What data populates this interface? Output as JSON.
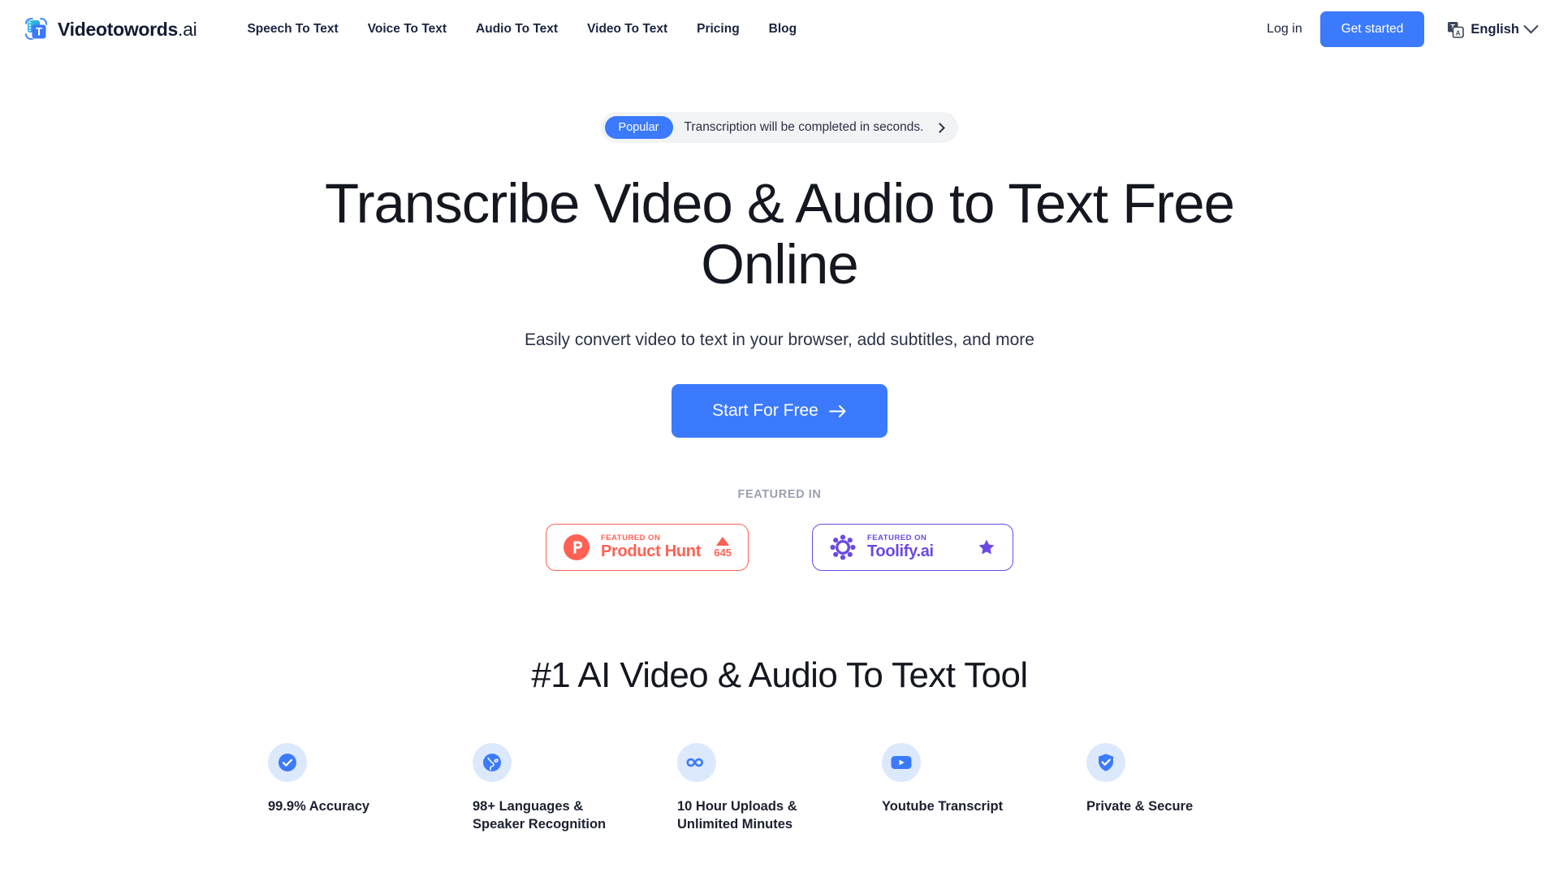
{
  "header": {
    "brand": {
      "name": "Videotowords",
      "suffix": ".ai",
      "logo_icon": "film-text-logo-icon"
    },
    "nav": [
      {
        "label": "Speech To Text"
      },
      {
        "label": "Voice To Text"
      },
      {
        "label": "Audio To Text"
      },
      {
        "label": "Video To Text"
      },
      {
        "label": "Pricing"
      },
      {
        "label": "Blog"
      }
    ],
    "login_label": "Log in",
    "get_started_label": "Get started",
    "language": {
      "label": "English",
      "icon": "translate-icon",
      "chevron": "chevron-down-icon"
    }
  },
  "hero": {
    "pill": {
      "badge": "Popular",
      "text": "Transcription will be completed in seconds.",
      "arrow": "chevron-right-icon"
    },
    "title": "Transcribe Video & Audio to Text Free Online",
    "subtitle": "Easily convert video to text in your browser, add subtitles, and more",
    "cta_label": "Start For Free",
    "cta_arrow": "arrow-right-icon",
    "featured_label": "FEATURED IN",
    "badges": [
      {
        "kicker": "FEATURED ON",
        "name": "Product Hunt",
        "votes": "645",
        "logo_icon": "product-hunt-icon",
        "accent": "#ff6154"
      },
      {
        "kicker": "FEATURED ON",
        "name": "Toolify.ai",
        "logo_icon": "toolify-icon",
        "star_icon": "star-icon",
        "accent": "#6b49e4"
      }
    ]
  },
  "section2": {
    "title": "#1 AI Video & Audio To Text Tool",
    "features": [
      {
        "label": "99.9% Accuracy",
        "icon": "check-circle-icon"
      },
      {
        "label": "98+ Languages & Speaker Recognition",
        "icon": "globe-icon"
      },
      {
        "label": "10 Hour Uploads & Unlimited Minutes",
        "icon": "infinity-icon"
      },
      {
        "label": "Youtube Transcript",
        "icon": "youtube-icon"
      },
      {
        "label": "Private & Secure",
        "icon": "shield-check-icon"
      }
    ]
  },
  "colors": {
    "brand_blue": "#3b7afc",
    "icon_bg": "#dce9fd",
    "text_dark": "#14171f",
    "muted": "#9aa1b0"
  }
}
